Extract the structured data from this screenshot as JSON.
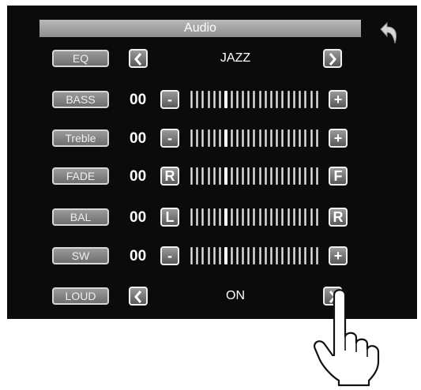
{
  "header": {
    "title": "Audio",
    "back_icon": "back-arrow-icon"
  },
  "rows": [
    {
      "id": "eq",
      "label": "EQ",
      "type": "selector",
      "value": "JAZZ"
    },
    {
      "id": "bass",
      "label": "BASS",
      "type": "slider",
      "value": "00",
      "left_btn": "-",
      "right_btn": "+",
      "level": 0.5
    },
    {
      "id": "treble",
      "label": "Treble",
      "type": "slider",
      "value": "00",
      "left_btn": "-",
      "right_btn": "+",
      "level": 0.5
    },
    {
      "id": "fade",
      "label": "FADE",
      "type": "slider",
      "value": "00",
      "left_btn": "R",
      "right_btn": "F",
      "level": 0.5
    },
    {
      "id": "bal",
      "label": "BAL",
      "type": "slider",
      "value": "00",
      "left_btn": "L",
      "right_btn": "R",
      "level": 0.5
    },
    {
      "id": "sw",
      "label": "SW",
      "type": "slider",
      "value": "00",
      "left_btn": "-",
      "right_btn": "+",
      "level": 0.5
    },
    {
      "id": "loud",
      "label": "LOUD",
      "type": "selector",
      "value": "ON"
    }
  ],
  "colors": {
    "panel": "#0b0b0b",
    "button": "#7a7a7a",
    "text": "#ffffff"
  },
  "overlay": {
    "icon": "pointing-hand-icon"
  }
}
